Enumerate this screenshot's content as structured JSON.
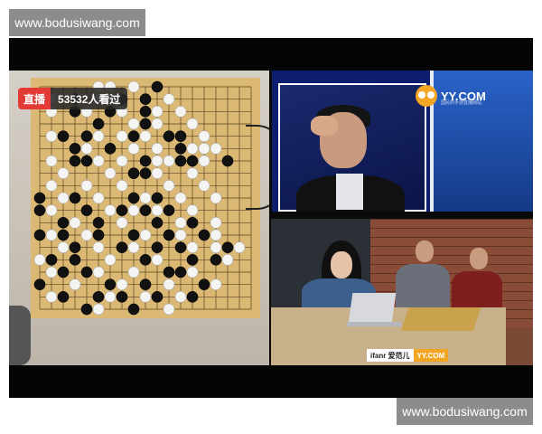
{
  "watermark": {
    "top_text": "www.bodusiwang.com",
    "bottom_text": "www.bodusiwang.com"
  },
  "live_badge": {
    "live_label": "直播",
    "viewers_label": "53532人看过"
  },
  "studio_logo": {
    "name": "YY.COM",
    "tagline": "国民的手游直播网站"
  },
  "lower_third": {
    "sponsor": "ifanr 爱范儿",
    "brand": "YY.COM"
  },
  "colors": {
    "live_red": "#e23b36",
    "board_wood": "#dbb974",
    "watermark_gray": "#8c8c8c",
    "yy_orange": "#f2a623"
  },
  "board": {
    "size": 19,
    "black": [
      [
        10,
        0
      ],
      [
        3,
        1
      ],
      [
        7,
        1
      ],
      [
        9,
        1
      ],
      [
        3,
        2
      ],
      [
        6,
        2
      ],
      [
        9,
        2
      ],
      [
        5,
        3
      ],
      [
        9,
        3
      ],
      [
        2,
        4
      ],
      [
        4,
        4
      ],
      [
        8,
        4
      ],
      [
        11,
        4
      ],
      [
        12,
        4
      ],
      [
        3,
        5
      ],
      [
        6,
        5
      ],
      [
        12,
        5
      ],
      [
        3,
        6
      ],
      [
        4,
        6
      ],
      [
        9,
        6
      ],
      [
        12,
        6
      ],
      [
        13,
        6
      ],
      [
        16,
        6
      ],
      [
        8,
        7
      ],
      [
        9,
        7
      ],
      [
        0,
        9
      ],
      [
        3,
        9
      ],
      [
        8,
        9
      ],
      [
        10,
        9
      ],
      [
        0,
        10
      ],
      [
        4,
        10
      ],
      [
        7,
        10
      ],
      [
        9,
        10
      ],
      [
        11,
        10
      ],
      [
        2,
        11
      ],
      [
        5,
        11
      ],
      [
        10,
        11
      ],
      [
        13,
        11
      ],
      [
        0,
        12
      ],
      [
        2,
        12
      ],
      [
        5,
        12
      ],
      [
        8,
        12
      ],
      [
        11,
        12
      ],
      [
        14,
        12
      ],
      [
        3,
        13
      ],
      [
        7,
        13
      ],
      [
        10,
        13
      ],
      [
        12,
        13
      ],
      [
        16,
        13
      ],
      [
        1,
        14
      ],
      [
        3,
        14
      ],
      [
        9,
        14
      ],
      [
        13,
        14
      ],
      [
        15,
        14
      ],
      [
        2,
        15
      ],
      [
        4,
        15
      ],
      [
        11,
        15
      ],
      [
        12,
        15
      ],
      [
        0,
        16
      ],
      [
        6,
        16
      ],
      [
        9,
        16
      ],
      [
        14,
        16
      ],
      [
        2,
        17
      ],
      [
        5,
        17
      ],
      [
        7,
        17
      ],
      [
        10,
        17
      ],
      [
        13,
        17
      ],
      [
        4,
        18
      ],
      [
        8,
        18
      ]
    ],
    "white": [
      [
        5,
        0
      ],
      [
        6,
        0
      ],
      [
        8,
        0
      ],
      [
        1,
        1
      ],
      [
        5,
        1
      ],
      [
        6,
        1
      ],
      [
        11,
        1
      ],
      [
        1,
        2
      ],
      [
        4,
        2
      ],
      [
        7,
        2
      ],
      [
        10,
        2
      ],
      [
        12,
        2
      ],
      [
        5,
        3
      ],
      [
        8,
        3
      ],
      [
        10,
        3
      ],
      [
        13,
        3
      ],
      [
        1,
        4
      ],
      [
        5,
        4
      ],
      [
        7,
        4
      ],
      [
        9,
        4
      ],
      [
        14,
        4
      ],
      [
        4,
        5
      ],
      [
        8,
        5
      ],
      [
        10,
        5
      ],
      [
        13,
        5
      ],
      [
        14,
        5
      ],
      [
        15,
        5
      ],
      [
        1,
        6
      ],
      [
        5,
        6
      ],
      [
        7,
        6
      ],
      [
        10,
        6
      ],
      [
        11,
        6
      ],
      [
        14,
        6
      ],
      [
        2,
        7
      ],
      [
        6,
        7
      ],
      [
        10,
        7
      ],
      [
        13,
        7
      ],
      [
        1,
        8
      ],
      [
        4,
        8
      ],
      [
        7,
        8
      ],
      [
        11,
        8
      ],
      [
        14,
        8
      ],
      [
        2,
        9
      ],
      [
        5,
        9
      ],
      [
        9,
        9
      ],
      [
        12,
        9
      ],
      [
        15,
        9
      ],
      [
        1,
        10
      ],
      [
        6,
        10
      ],
      [
        8,
        10
      ],
      [
        10,
        10
      ],
      [
        13,
        10
      ],
      [
        3,
        11
      ],
      [
        7,
        11
      ],
      [
        12,
        11
      ],
      [
        15,
        11
      ],
      [
        1,
        12
      ],
      [
        4,
        12
      ],
      [
        9,
        12
      ],
      [
        12,
        12
      ],
      [
        15,
        12
      ],
      [
        2,
        13
      ],
      [
        5,
        13
      ],
      [
        8,
        13
      ],
      [
        13,
        13
      ],
      [
        15,
        13
      ],
      [
        17,
        13
      ],
      [
        0,
        14
      ],
      [
        6,
        14
      ],
      [
        10,
        14
      ],
      [
        16,
        14
      ],
      [
        1,
        15
      ],
      [
        5,
        15
      ],
      [
        8,
        15
      ],
      [
        13,
        15
      ],
      [
        3,
        16
      ],
      [
        7,
        16
      ],
      [
        11,
        16
      ],
      [
        15,
        16
      ],
      [
        1,
        17
      ],
      [
        6,
        17
      ],
      [
        9,
        17
      ],
      [
        12,
        17
      ],
      [
        5,
        18
      ],
      [
        11,
        18
      ]
    ]
  }
}
